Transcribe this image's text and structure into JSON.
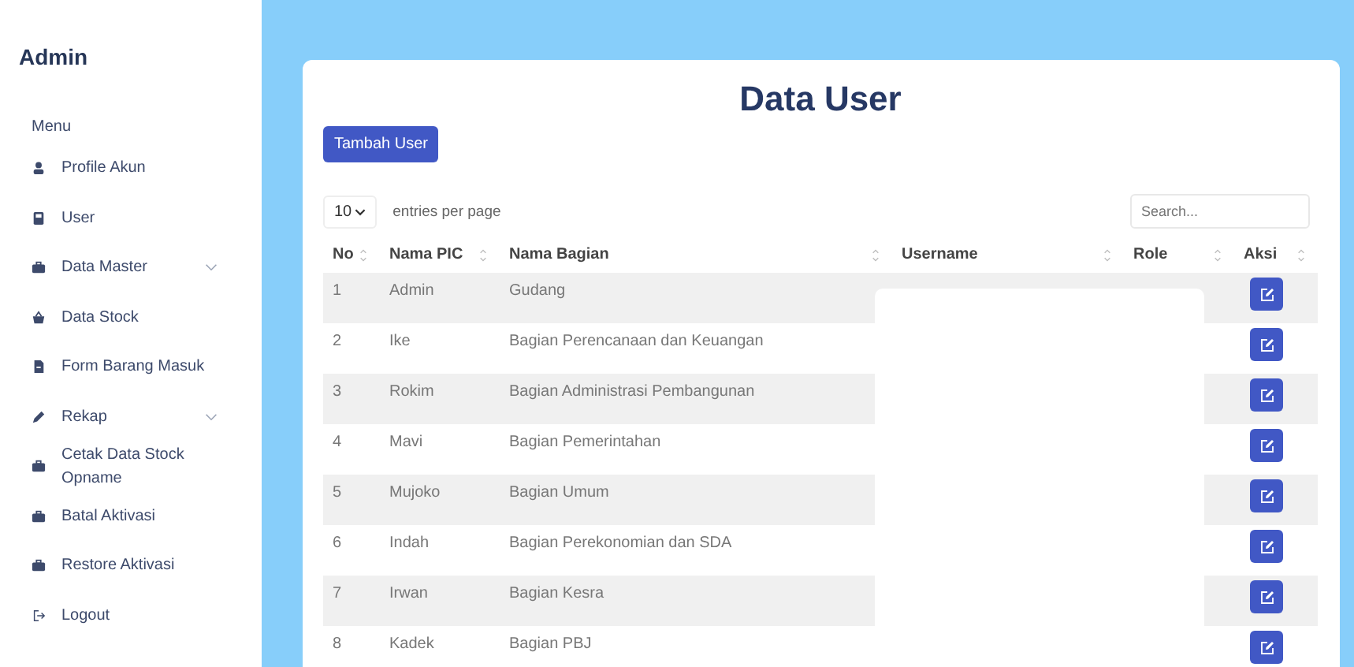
{
  "sidebar": {
    "title": "Admin",
    "section": "Menu",
    "items": [
      {
        "label": "Profile Akun",
        "has_submenu": false
      },
      {
        "label": "User",
        "has_submenu": false
      },
      {
        "label": "Data Master",
        "has_submenu": true
      },
      {
        "label": "Data Stock",
        "has_submenu": false
      },
      {
        "label": "Form Barang Masuk",
        "has_submenu": false
      },
      {
        "label": "Rekap",
        "has_submenu": true
      },
      {
        "label": "Cetak Data Stock Opname",
        "has_submenu": false
      },
      {
        "label": "Batal Aktivasi",
        "has_submenu": false
      },
      {
        "label": "Restore Aktivasi",
        "has_submenu": false
      },
      {
        "label": "Logout",
        "has_submenu": false
      }
    ]
  },
  "page": {
    "title": "Data User",
    "add_button": "Tambah User",
    "entries_value": "10",
    "entries_label": "entries per page",
    "search": {
      "placeholder": "Search..."
    }
  },
  "table": {
    "columns": [
      "No",
      "Nama PIC",
      "Nama Bagian",
      "Username",
      "Role",
      "Aksi"
    ],
    "rows": [
      {
        "no": "1",
        "pic": "Admin",
        "bagian": "Gudang"
      },
      {
        "no": "2",
        "pic": "Ike",
        "bagian": "Bagian Perencanaan dan Keuangan"
      },
      {
        "no": "3",
        "pic": "Rokim",
        "bagian": "Bagian Administrasi Pembangunan"
      },
      {
        "no": "4",
        "pic": "Mavi",
        "bagian": "Bagian Pemerintahan"
      },
      {
        "no": "5",
        "pic": "Mujoko",
        "bagian": "Bagian Umum"
      },
      {
        "no": "6",
        "pic": "Indah",
        "bagian": "Bagian Perekonomian dan SDA"
      },
      {
        "no": "7",
        "pic": "Irwan",
        "bagian": "Bagian Kesra"
      },
      {
        "no": "8",
        "pic": "Kadek",
        "bagian": "Bagian PBJ"
      }
    ]
  }
}
